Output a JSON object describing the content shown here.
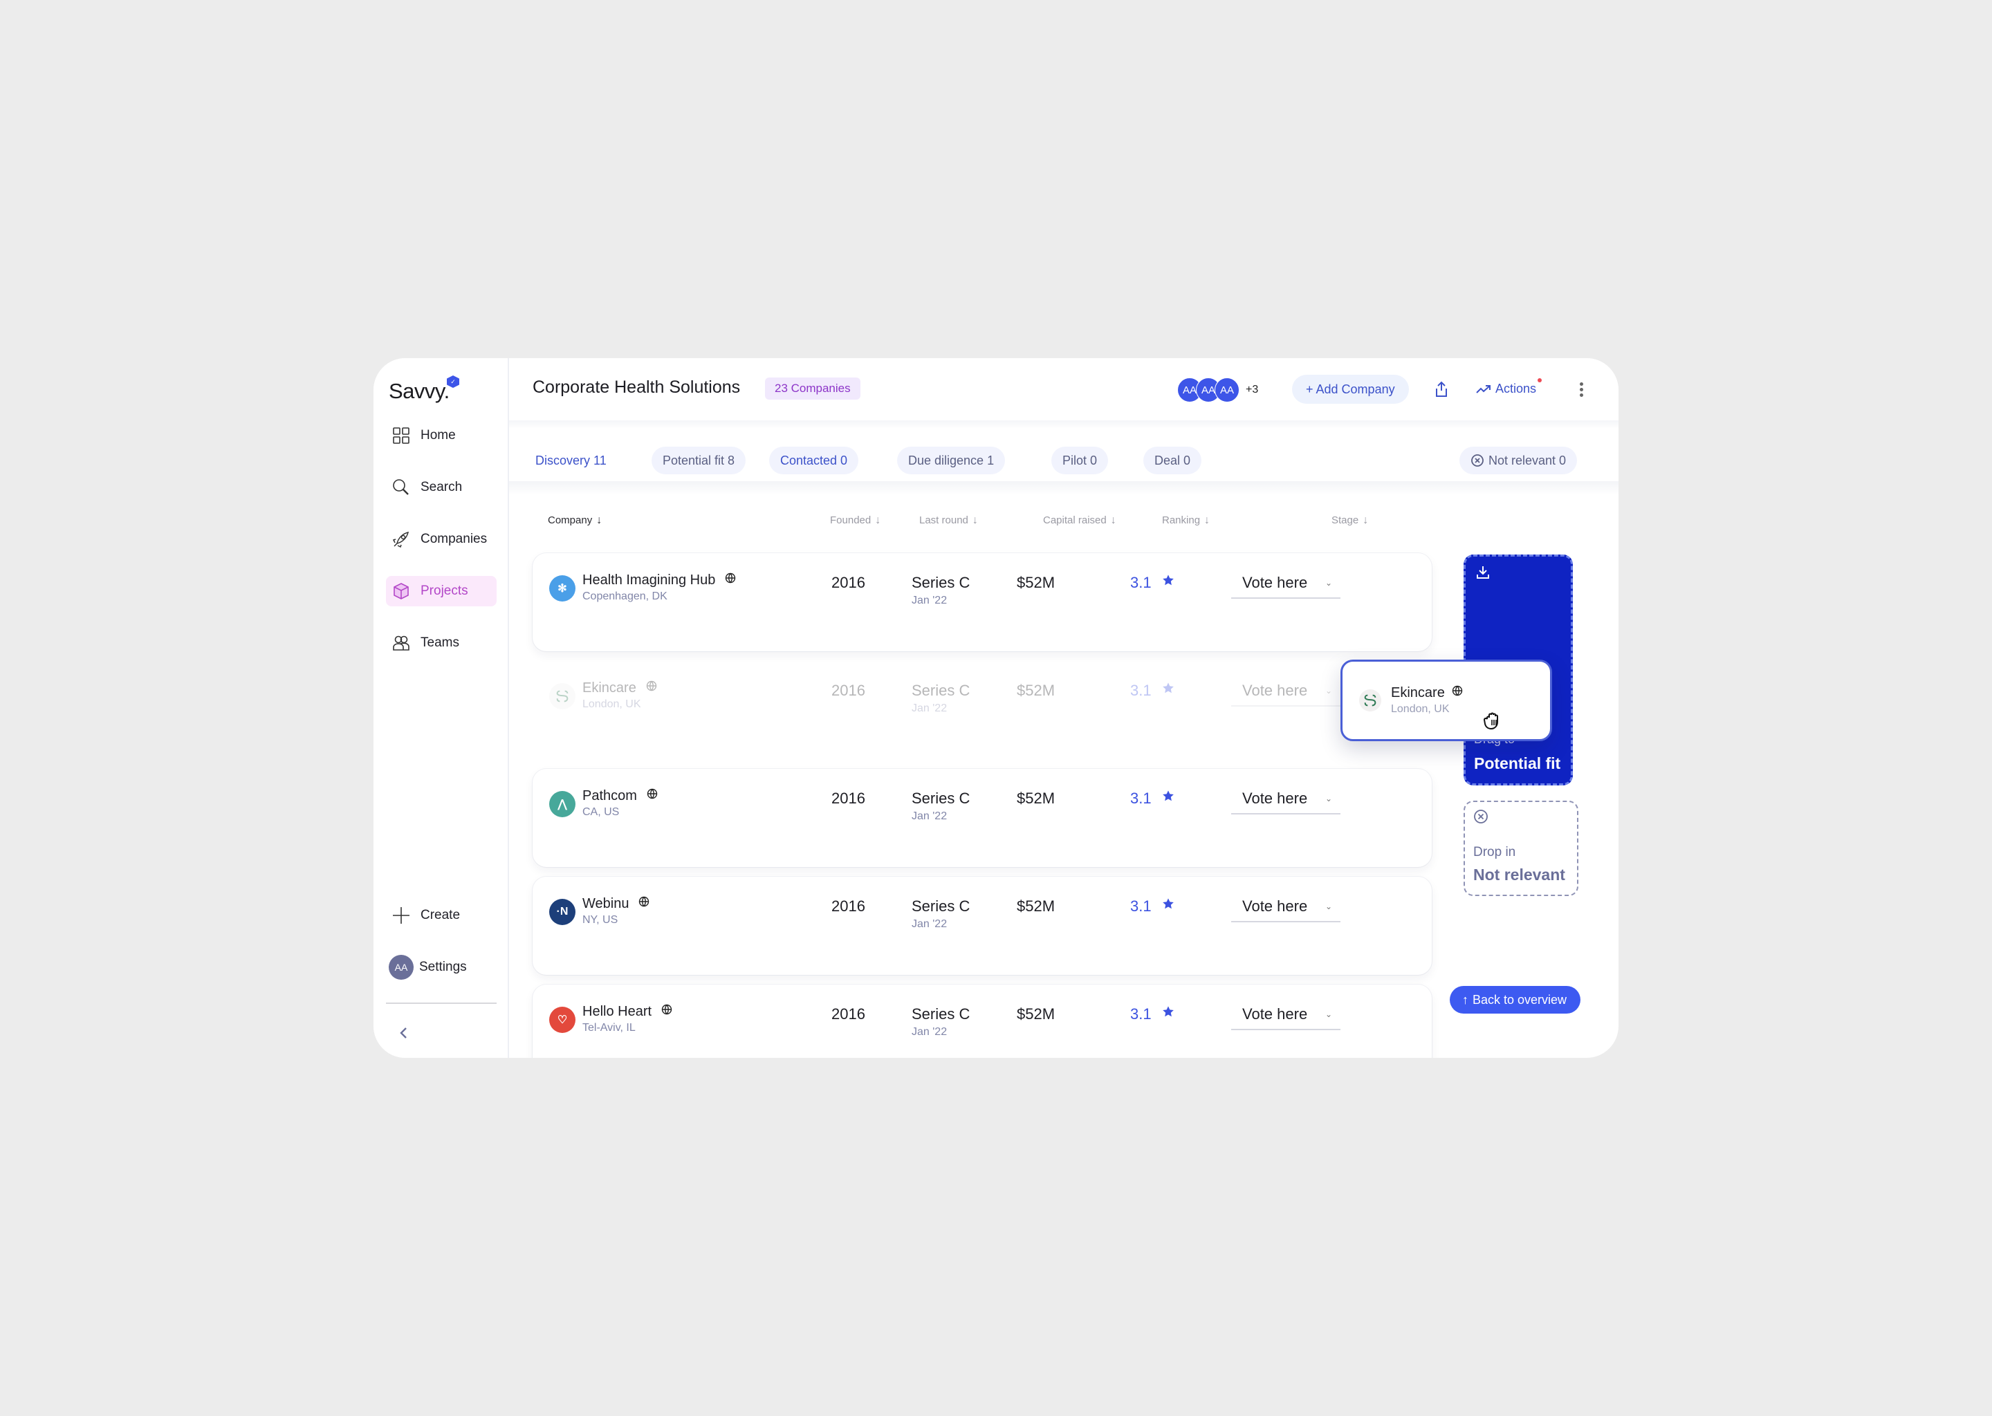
{
  "app": {
    "logo": "Savvy."
  },
  "sidebar": {
    "items": [
      {
        "label": "Home",
        "icon": "grid-icon"
      },
      {
        "label": "Search",
        "icon": "search-icon"
      },
      {
        "label": "Companies",
        "icon": "rocket-icon"
      },
      {
        "label": "Projects",
        "icon": "cube-icon",
        "active": true
      },
      {
        "label": "Teams",
        "icon": "people-icon"
      }
    ],
    "create_label": "Create",
    "settings_label": "Settings",
    "settings_avatar": "AA"
  },
  "header": {
    "title": "Corporate Health Solutions",
    "count_badge": "23 Companies",
    "avatars": [
      "AA",
      "AA",
      "AA"
    ],
    "avatars_more": "+3",
    "add_company_label": "+ Add Company",
    "actions_label": "Actions"
  },
  "tabs": [
    {
      "label": "Discovery 11",
      "active": true
    },
    {
      "label": "Potential fit 8"
    },
    {
      "label": "Contacted 0"
    },
    {
      "label": "Due diligence 1"
    },
    {
      "label": "Pilot 0"
    },
    {
      "label": "Deal 0"
    },
    {
      "label": "Not relevant 0"
    }
  ],
  "table": {
    "columns": [
      "Company",
      "Founded",
      "Last round",
      "Capital raised",
      "Ranking",
      "Stage"
    ],
    "sort_arrow": "↓",
    "rows": [
      {
        "name": "Health Imagining Hub",
        "location": "Copenhagen, DK",
        "founded": "2016",
        "last_round": "Series C",
        "round_date": "Jan '22",
        "capital": "$52M",
        "ranking": "3.1",
        "stage": "Vote here",
        "logo_color": "#4a9fe8",
        "logo_glyph": "✻"
      },
      {
        "name": "Ekincare",
        "location": "London, UK",
        "founded": "2016",
        "last_round": "Series C",
        "round_date": "Jan '22",
        "capital": "$52M",
        "ranking": "3.1",
        "stage": "Vote here",
        "logo_color": "#f2f0f0",
        "logo_glyph": "",
        "dragging": true
      },
      {
        "name": "Pathcom",
        "location": "CA, US",
        "founded": "2016",
        "last_round": "Series C",
        "round_date": "Jan '22",
        "capital": "$52M",
        "ranking": "3.1",
        "stage": "Vote here",
        "logo_color": "#47a89a",
        "logo_glyph": "⋀"
      },
      {
        "name": "Webinu",
        "location": "NY, US",
        "founded": "2016",
        "last_round": "Series C",
        "round_date": "Jan '22",
        "capital": "$52M",
        "ranking": "3.1",
        "stage": "Vote here",
        "logo_color": "#1d3f7a",
        "logo_glyph": "·N"
      },
      {
        "name": "Hello Heart",
        "location": "Tel-Aviv, IL",
        "founded": "2016",
        "last_round": "Series C",
        "round_date": "Jan '22",
        "capital": "$52M",
        "ranking": "3.1",
        "stage": "Vote here",
        "logo_color": "#e3493c",
        "logo_glyph": "♡"
      }
    ]
  },
  "drag": {
    "card_name": "Ekincare",
    "card_location": "London, UK",
    "fit_zone_prefix": "Drag to",
    "fit_zone_target": "Potential fit",
    "nr_zone_prefix": "Drop in",
    "nr_zone_target": "Not relevant"
  },
  "back_to_overview_label": "Back to overview",
  "colors": {
    "accent": "#3d55e8",
    "drop_zone": "#0f23c2",
    "projects_active": "#b347c8",
    "rating": "#3c52e0"
  }
}
